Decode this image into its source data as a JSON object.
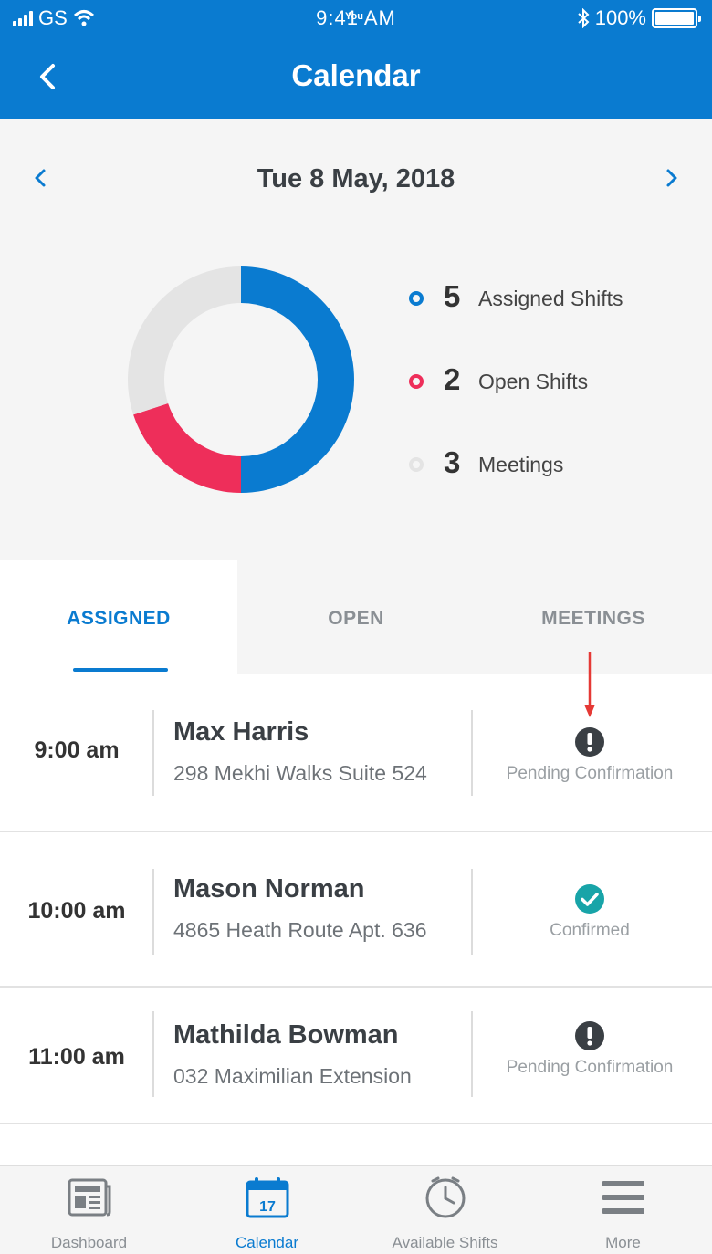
{
  "status_bar": {
    "carrier": "GS",
    "time": "9:41 AM",
    "overlay_label": "You",
    "battery": "100%"
  },
  "header": {
    "title": "Calendar",
    "back_icon": "chevron-left-icon"
  },
  "date_nav": {
    "date": "Tue 8 May, 2018",
    "prev_icon": "chevron-left-icon",
    "next_icon": "chevron-right-icon"
  },
  "summary": {
    "legend": [
      {
        "count": "5",
        "label": "Assigned Shifts",
        "color": "#0a7bd0"
      },
      {
        "count": "2",
        "label": "Open Shifts",
        "color": "#ee2e5a"
      },
      {
        "count": "3",
        "label": "Meetings",
        "color": "#e4e4e4"
      }
    ],
    "donut": {
      "values": [
        5,
        2,
        3
      ],
      "colors": [
        "#0a7bd0",
        "#ee2e5a",
        "#e4e4e4"
      ]
    }
  },
  "tabs": [
    {
      "label": "ASSIGNED",
      "active": true
    },
    {
      "label": "OPEN",
      "active": false
    },
    {
      "label": "MEETINGS",
      "active": false
    }
  ],
  "shifts": [
    {
      "time": "9:00 am",
      "name": "Max Harris",
      "address": "298 Mekhi Walks Suite 524",
      "status": "Pending Confirmation",
      "status_icon": "exclamation-icon"
    },
    {
      "time": "10:00 am",
      "name": "Mason Norman",
      "address": "4865 Heath Route Apt. 636",
      "status": "Confirmed",
      "status_icon": "check-circle-icon"
    },
    {
      "time": "11:00 am",
      "name": "Mathilda Bowman",
      "address": "032 Maximilian Extension",
      "status": "Pending Confirmation",
      "status_icon": "exclamation-icon"
    }
  ],
  "tab_bar": [
    {
      "label": "Dashboard",
      "icon": "newspaper-icon",
      "active": false
    },
    {
      "label": "Calendar",
      "icon": "calendar-icon",
      "icon_text": "17",
      "active": true
    },
    {
      "label": "Available Shifts",
      "icon": "clock-icon",
      "active": false
    },
    {
      "label": "More",
      "icon": "hamburger-icon",
      "active": false
    }
  ],
  "colors": {
    "brand_blue": "#0a7bd0",
    "open_pink": "#ee2e5a",
    "confirmed_teal": "#18a4a8",
    "annotation_red": "#e53935"
  }
}
